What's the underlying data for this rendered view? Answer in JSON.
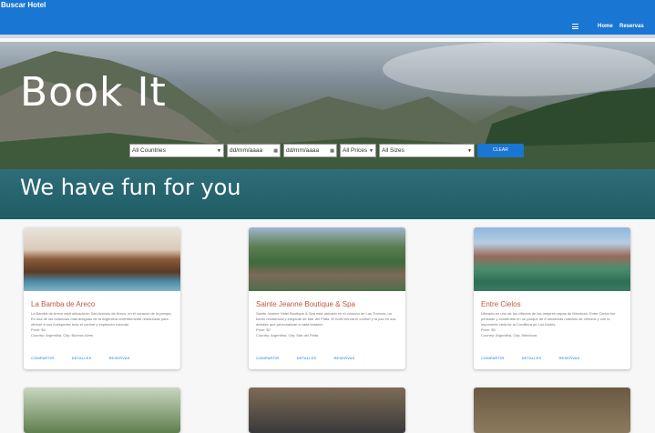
{
  "header": {
    "brand": "Buscar Hotel",
    "nav": [
      "Home",
      "Reservas"
    ]
  },
  "hero": {
    "title": "Book It",
    "subtitle": "We have fun for you"
  },
  "search": {
    "countries": "All Countries",
    "date_from": "dd/mm/aaaa",
    "date_to": "dd/mm/aaaa",
    "prices": "All Prices",
    "sizes": "All Sizes",
    "clear": "CLEAR"
  },
  "cards": [
    {
      "title": "La Bamba de Areco",
      "desc": "La Bamba de Areco está ubicada en San Antonio de Areco, en el corazón de la pampa. Es una de las estancias más antiguas de la Argentina recientemente restaurada para ofrecer a sus huéspedes todo el confort y esplendor colonial.",
      "price": "Price: $4",
      "location": "Country: Argentina, City: Buenos Aires",
      "actions": [
        "COMPARTIR",
        "DETALLES",
        "RESERVAS"
      ]
    },
    {
      "title": "Sainte Jeanne Boutique & Spa",
      "desc": "Sainte Jeanne Hotel Boutique & Spa está ubicado en el corazón de Los Troncos, un barrio residencial y elegante de Mar del Plata. El hotel brinda el confort y la paz en sus detalles que personalizan a cada estadía.",
      "price": "Price: $2",
      "location": "Country: Argentina, City: Mar del Plata",
      "actions": [
        "COMPARTIR",
        "DETALLES",
        "RESERVAS"
      ]
    },
    {
      "title": "Entre Cielos",
      "desc": "Ubicado en uno de los viñedos de las mejores cepas de Mendoza, Entre Cielos fue pensado y construido en un parque de 8 hectáreas rodeado de viñedos y con la imponente vista de la Cordillera de Los Andes.",
      "price": "Price: $3",
      "location": "Country: Argentina, City: Mendoza",
      "actions": [
        "COMPARTIR",
        "DETALLES",
        "RESERVAS"
      ]
    }
  ],
  "colors": {
    "primary": "#1976d2",
    "card_title": "#c05a3e"
  }
}
